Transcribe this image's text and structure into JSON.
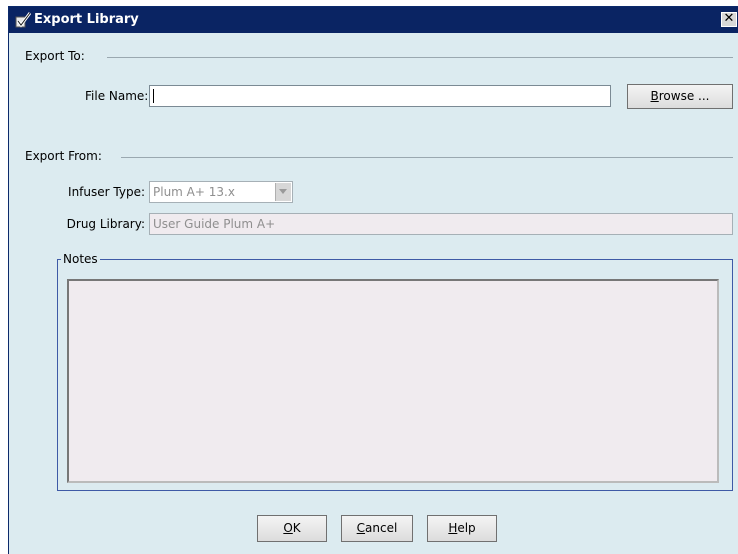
{
  "window": {
    "title": "Export Library",
    "close_label": "✕"
  },
  "export_to": {
    "section_label": "Export To:",
    "file_name_label": "File Name:",
    "file_name_value": "",
    "browse_label_ul": "B",
    "browse_label_rest": "rowse ..."
  },
  "export_from": {
    "section_label": "Export From:",
    "infuser_type_label": "Infuser Type:",
    "infuser_type_value": "Plum A+ 13.x",
    "drug_library_label": "Drug Library:",
    "drug_library_value": "User Guide Plum A+"
  },
  "notes": {
    "group_label": "Notes",
    "value": ""
  },
  "buttons": {
    "ok_ul": "O",
    "ok_rest": "K",
    "cancel_ul": "C",
    "cancel_rest": "ancel",
    "help_ul": "H",
    "help_rest": "elp"
  },
  "icons": {
    "app": "checkmark-library-icon",
    "close": "close-icon",
    "dropdown": "chevron-down-icon"
  }
}
